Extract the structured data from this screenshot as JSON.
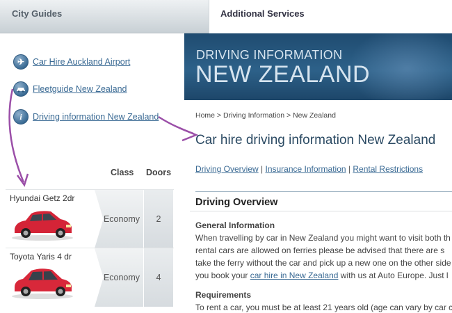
{
  "tabs": [
    {
      "label": "City Guides"
    },
    {
      "label": "Additional Services"
    }
  ],
  "side_links": [
    {
      "label": "Car Hire Auckland Airport",
      "icon": "plane-icon"
    },
    {
      "label": "Fleetguide New Zealand",
      "icon": "car-icon"
    },
    {
      "label": "Driving information New Zealand",
      "icon": "info-icon"
    }
  ],
  "table": {
    "columns": [
      "Class",
      "Doors"
    ],
    "rows": [
      {
        "name": "Hyundai Getz 2dr",
        "class": "Economy",
        "doors": "2"
      },
      {
        "name": "Toyota Yaris 4 dr",
        "class": "Economy",
        "doors": "4"
      }
    ]
  },
  "banner": {
    "small": "DRIVING INFORMATION",
    "big": "NEW ZEALAND"
  },
  "breadcrumb": "Home > Driving Information > New Zealand",
  "title": "Car hire driving information New Zealand",
  "sublinks": [
    "Driving Overview",
    "Insurance Information",
    "Rental Restrictions"
  ],
  "section": {
    "heading": "Driving Overview",
    "general_heading": "General Information",
    "general_lines": [
      "When travelling by car in New Zealand you might want to visit both th",
      "rental cars are allowed on ferries please be advised that there are s",
      "take the ferry without the car and pick up a new one on the other side"
    ],
    "line4_before": "you book your ",
    "line4_link": "car hire in New Zealand",
    "line4_after": " with us at Auto Europe. Just l",
    "requirements_heading": "Requirements",
    "requirements_line": "To rent a car, you must be at least 21 years old (age can vary by car c"
  },
  "colors": {
    "link": "#3a6a94",
    "banner": "#2d6189",
    "arrow": "#9b4fa8"
  }
}
